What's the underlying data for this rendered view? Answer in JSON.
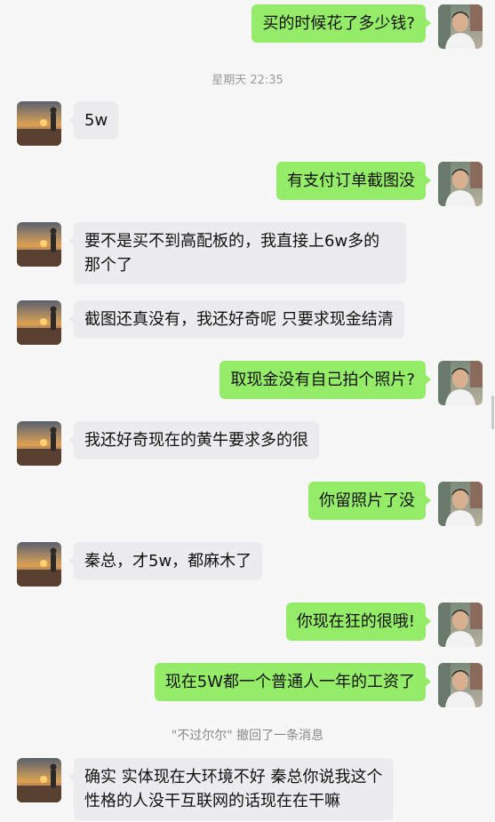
{
  "chat": {
    "messages": [
      {
        "sender": "me",
        "text": "买的时候花了多少钱?"
      },
      {
        "sender": "them",
        "text": "5w"
      },
      {
        "sender": "me",
        "text": "有支付订单截图没"
      },
      {
        "sender": "them",
        "text": "要不是买不到高配板的，我直接上6w多的那个了"
      },
      {
        "sender": "them",
        "text": "截图还真没有，我还好奇呢 只要求现金结清"
      },
      {
        "sender": "me",
        "text": "取现金没有自己拍个照片?"
      },
      {
        "sender": "them",
        "text": "我还好奇现在的黄牛要求多的很"
      },
      {
        "sender": "me",
        "text": "你留照片了没"
      },
      {
        "sender": "them",
        "text": "秦总，才5w，都麻木了"
      },
      {
        "sender": "me",
        "text": "你现在狂的很哦!"
      },
      {
        "sender": "me",
        "text": "现在5W都一个普通人一年的工资了"
      },
      {
        "sender": "them",
        "text": "确实 实体现在大环境不好 秦总你说我这个性格的人没干互联网的话现在在干嘛"
      }
    ],
    "timestamp": "星期天 22:35",
    "recall_notice": "\"不过尔尔\" 撤回了一条消息",
    "avatars": {
      "me": "avatar-man-photo",
      "them": "avatar-sunset-photo"
    }
  },
  "colors": {
    "background": "#f7f7f8",
    "my_bubble": "#95ec69",
    "their_bubble": "#ececef",
    "system_text": "#9a9a9a"
  }
}
